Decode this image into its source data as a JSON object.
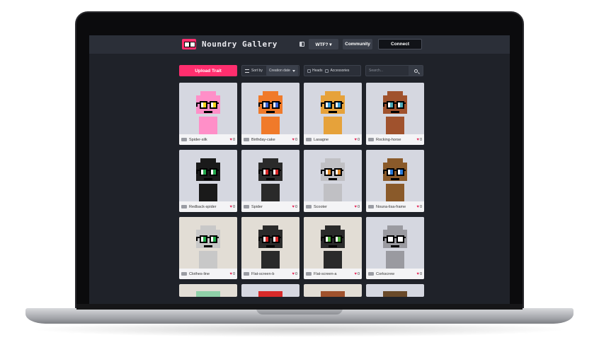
{
  "app": {
    "brand": "Noundry Gallery"
  },
  "nav": {
    "wtf_label": "WTF? ▾",
    "community_label": "Community",
    "connect_label": "Connect"
  },
  "toolbar": {
    "upload_label": "Upload Trait",
    "sort_label": "Sort by",
    "sort_selected": "Creation date",
    "filter_heads": "Heads",
    "filter_accessories": "Accessories",
    "search_placeholder": "Search..."
  },
  "colors": {
    "accent": "#ff2e6e",
    "screen_bg": "#1f2229",
    "nav_bg": "#2b2f38",
    "heart": "#e32b5a"
  },
  "traits": [
    {
      "name": "Spider-silk",
      "likes": "0",
      "bg": "#d5d7e0",
      "main": "#ff8fc8",
      "glass": "#f2d41a"
    },
    {
      "name": "Birthday-cake",
      "likes": "0",
      "bg": "#d5d7e0",
      "main": "#f07a2a",
      "glass": "#3a63d8"
    },
    {
      "name": "Lasagne",
      "likes": "0",
      "bg": "#d5d7e0",
      "main": "#e6a23a",
      "glass": "#3a9fd8"
    },
    {
      "name": "Rocking-horse",
      "likes": "0",
      "bg": "#d5d7e0",
      "main": "#a0522d",
      "glass": "#4aa8b8"
    },
    {
      "name": "Redback-spider",
      "likes": "0",
      "bg": "#d5d7e0",
      "main": "#1a1a1a",
      "glass": "#22a84a"
    },
    {
      "name": "Spider",
      "likes": "0",
      "bg": "#d5d7e0",
      "main": "#2a2a2a",
      "glass": "#d82a2a"
    },
    {
      "name": "Scooter",
      "likes": "0",
      "bg": "#d5d7e0",
      "main": "#c0c0c4",
      "glass": "#e08a2a"
    },
    {
      "name": "Nouna-lisa-frame",
      "likes": "0",
      "bg": "#d5d7e0",
      "main": "#8a5a2a",
      "glass": "#2a7ad8"
    },
    {
      "name": "Clothes-line",
      "likes": "0",
      "bg": "#e2ddd5",
      "main": "#c8c8c8",
      "glass": "#22a84a"
    },
    {
      "name": "Flat-screen-b",
      "likes": "0",
      "bg": "#e2ddd5",
      "main": "#2a2a2a",
      "glass": "#d82a2a"
    },
    {
      "name": "Flat-screen-a",
      "likes": "0",
      "bg": "#e2ddd5",
      "main": "#2a2a2a",
      "glass": "#4aa83a"
    },
    {
      "name": "Corkscrew",
      "likes": "0",
      "bg": "#d5d7e0",
      "main": "#9a9aa0",
      "glass": "#ffffff"
    }
  ],
  "peek_rows": [
    {
      "bg": "#e2ddd5",
      "main": "#8fd0a8"
    },
    {
      "bg": "#d5d7e0",
      "main": "#d82a2a"
    },
    {
      "bg": "#e2ddd5",
      "main": "#a0522d"
    },
    {
      "bg": "#d5d7e0",
      "main": "#6a4a2a"
    }
  ]
}
